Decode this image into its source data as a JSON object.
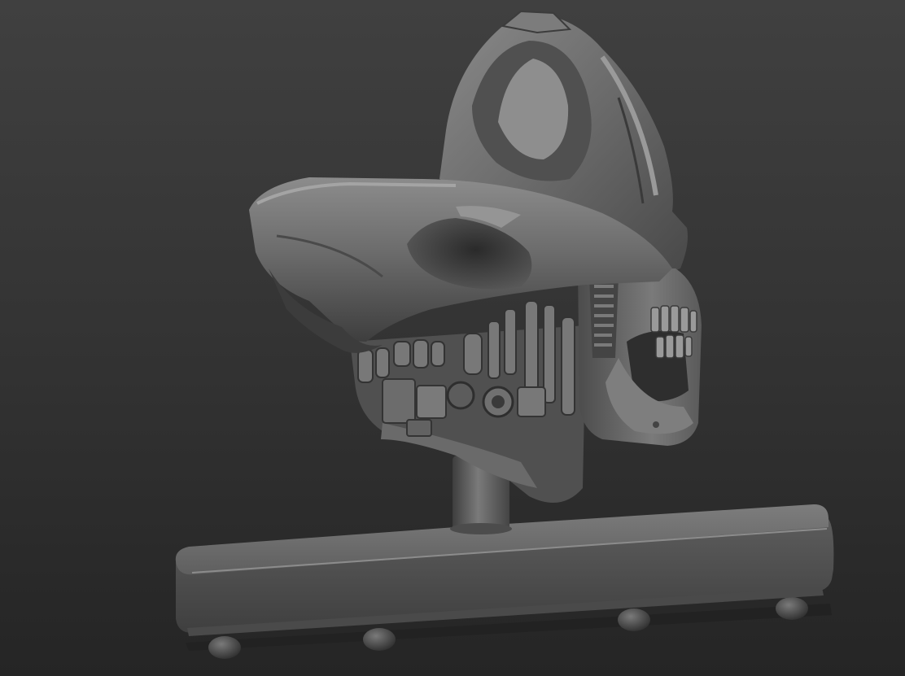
{
  "viewport": {
    "background_top": "#3f3f3f",
    "background_bottom": "#262626",
    "model_color": "#6e6e6e",
    "model_shadow": "#2c2c2c",
    "model_highlight": "#a6a6a6"
  },
  "model": {
    "subject": "mech-skull-sculpt",
    "parts": [
      "helmet-dome",
      "faceplate",
      "eye-socket",
      "jaw-teeth",
      "neck-mechanics",
      "support-pole",
      "display-base",
      "base-feet"
    ]
  }
}
